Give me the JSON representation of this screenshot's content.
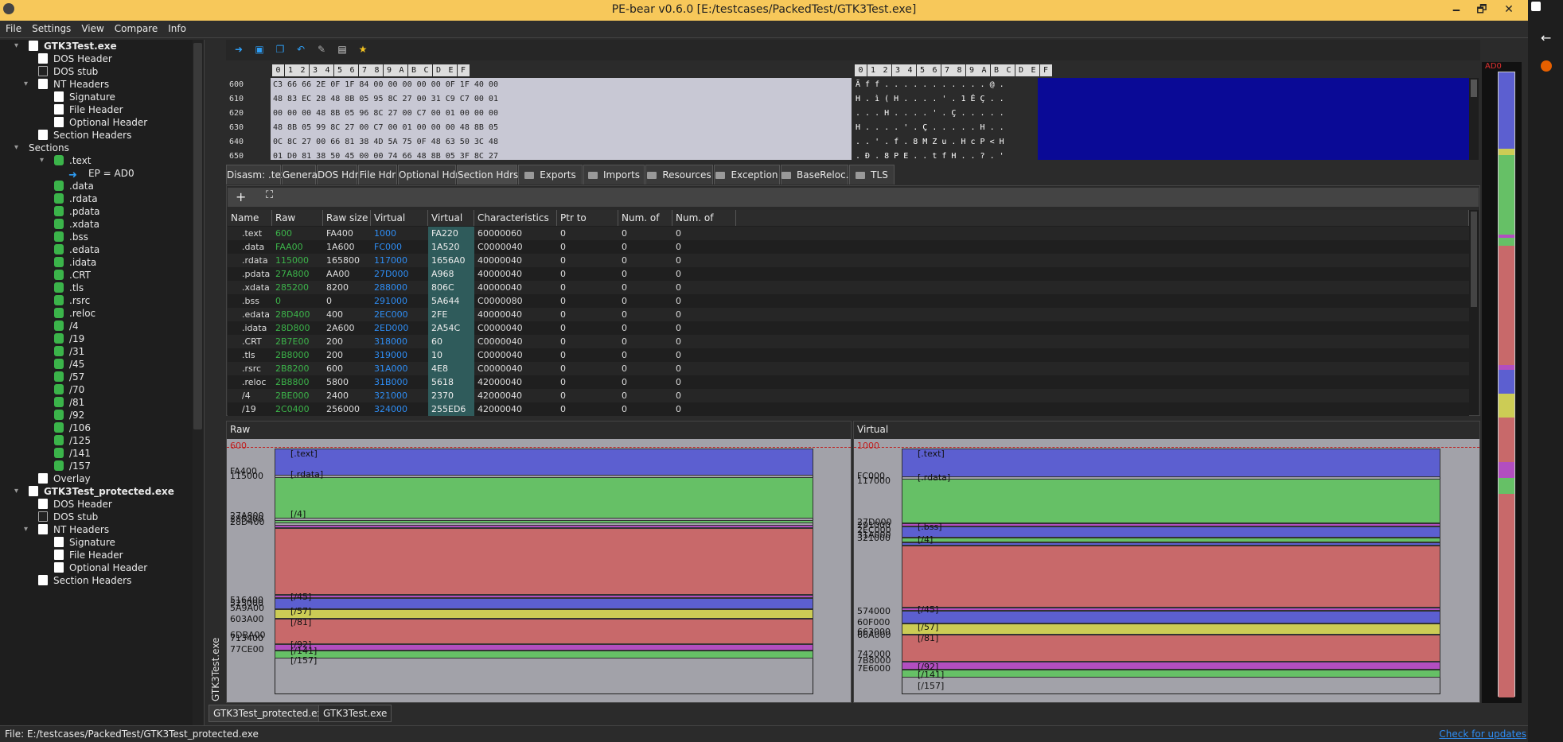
{
  "window": {
    "title": "PE-bear v0.6.0 [E:/testcases/PackedTest/GTK3Test.exe]",
    "minimize": "🗕",
    "maximize": "🗗",
    "close": "✕"
  },
  "menu": [
    "File",
    "Settings",
    "View",
    "Compare",
    "Info"
  ],
  "tree": [
    {
      "label": "GTK3Test.exe",
      "level": 0,
      "icon": "pe-file-icon",
      "bold": true,
      "expander": "▾"
    },
    {
      "label": "DOS Header",
      "level": 1,
      "icon": "page-icon"
    },
    {
      "label": "DOS stub",
      "level": 1,
      "icon": "terminal-icon"
    },
    {
      "label": "NT Headers",
      "level": 1,
      "icon": "page-icon",
      "expander": "▾"
    },
    {
      "label": "Signature",
      "level": 2,
      "icon": "page-icon"
    },
    {
      "label": "File Header",
      "level": 2,
      "icon": "page-icon"
    },
    {
      "label": "Optional Header",
      "level": 2,
      "icon": "page-icon"
    },
    {
      "label": "Section Headers",
      "level": 1,
      "icon": "page-icon"
    },
    {
      "label": "Sections",
      "level": 0.5,
      "icon": "",
      "expander": "▾"
    },
    {
      "label": ".text",
      "level": 2,
      "icon": "puzzle-icon",
      "expander": "▾"
    },
    {
      "label": "EP = AD0",
      "level": 3,
      "icon": "arrow-icon"
    },
    {
      "label": ".data",
      "level": 2,
      "icon": "puzzle-icon"
    },
    {
      "label": ".rdata",
      "level": 2,
      "icon": "puzzle-icon"
    },
    {
      "label": ".pdata",
      "level": 2,
      "icon": "puzzle-icon"
    },
    {
      "label": ".xdata",
      "level": 2,
      "icon": "puzzle-icon"
    },
    {
      "label": ".bss",
      "level": 2,
      "icon": "puzzle-icon"
    },
    {
      "label": ".edata",
      "level": 2,
      "icon": "puzzle-icon"
    },
    {
      "label": ".idata",
      "level": 2,
      "icon": "puzzle-icon"
    },
    {
      "label": ".CRT",
      "level": 2,
      "icon": "puzzle-icon"
    },
    {
      "label": ".tls",
      "level": 2,
      "icon": "puzzle-icon"
    },
    {
      "label": ".rsrc",
      "level": 2,
      "icon": "puzzle-icon"
    },
    {
      "label": ".reloc",
      "level": 2,
      "icon": "puzzle-icon"
    },
    {
      "label": "/4",
      "level": 2,
      "icon": "puzzle-icon"
    },
    {
      "label": "/19",
      "level": 2,
      "icon": "puzzle-icon"
    },
    {
      "label": "/31",
      "level": 2,
      "icon": "puzzle-icon"
    },
    {
      "label": "/45",
      "level": 2,
      "icon": "puzzle-icon"
    },
    {
      "label": "/57",
      "level": 2,
      "icon": "puzzle-icon"
    },
    {
      "label": "/70",
      "level": 2,
      "icon": "puzzle-icon"
    },
    {
      "label": "/81",
      "level": 2,
      "icon": "puzzle-icon"
    },
    {
      "label": "/92",
      "level": 2,
      "icon": "puzzle-icon"
    },
    {
      "label": "/106",
      "level": 2,
      "icon": "puzzle-icon"
    },
    {
      "label": "/125",
      "level": 2,
      "icon": "puzzle-icon"
    },
    {
      "label": "/141",
      "level": 2,
      "icon": "puzzle-icon"
    },
    {
      "label": "/157",
      "level": 2,
      "icon": "puzzle-icon"
    },
    {
      "label": "Overlay",
      "level": 1,
      "icon": "page-icon"
    },
    {
      "label": "GTK3Test_protected.exe",
      "level": 0,
      "icon": "pe-file-icon",
      "bold": true,
      "expander": "▾"
    },
    {
      "label": "DOS Header",
      "level": 1,
      "icon": "page-icon"
    },
    {
      "label": "DOS stub",
      "level": 1,
      "icon": "terminal-icon"
    },
    {
      "label": "NT Headers",
      "level": 1,
      "icon": "page-icon",
      "expander": "▾"
    },
    {
      "label": "Signature",
      "level": 2,
      "icon": "page-icon"
    },
    {
      "label": "File Header",
      "level": 2,
      "icon": "page-icon"
    },
    {
      "label": "Optional Header",
      "level": 2,
      "icon": "page-icon"
    },
    {
      "label": "Section Headers",
      "level": 1,
      "icon": "page-icon"
    }
  ],
  "vertical_tab": "GTK3Test.exe",
  "hex": {
    "columns": [
      "0",
      "1",
      "2",
      "3",
      "4",
      "5",
      "6",
      "7",
      "8",
      "9",
      "A",
      "B",
      "C",
      "D",
      "E",
      "F"
    ],
    "rows": [
      {
        "addr": "600",
        "bytes": "C3 66 66 2E 0F 1F 84 00 00 00 00 00 0F 1F 40 00",
        "ascii": "Ã f f . . . . . . . . . . . @ ."
      },
      {
        "addr": "610",
        "bytes": "48 83 EC 28 48 8B 05 95 8C 27 00 31 C9 C7 00 01",
        "ascii": "H . ì ( H . . . . ' . 1 É Ç . ."
      },
      {
        "addr": "620",
        "bytes": "00 00 00 48 8B 05 96 8C 27 00 C7 00 01 00 00 00",
        "ascii": ". . . H . . . . ' . Ç . . . . ."
      },
      {
        "addr": "630",
        "bytes": "48 8B 05 99 8C 27 00 C7 00 01 00 00 00 48 8B 05",
        "ascii": "H . . . . ' . Ç . . . . . H . ."
      },
      {
        "addr": "640",
        "bytes": "0C 8C 27 00 66 81 38 4D 5A 75 0F 48 63 50 3C 48",
        "ascii": ". . ' . f . 8 M Z u . H c P < H"
      },
      {
        "addr": "650",
        "bytes": "01 D0 81 38 50 45 00 00 74 66 48 8B 05 3F 8C 27",
        "ascii": ". Ð . 8 P E . . t f H . . ? . '"
      }
    ]
  },
  "tabs": [
    {
      "label": "Disasm: .text"
    },
    {
      "label": "General"
    },
    {
      "label": "DOS Hdr"
    },
    {
      "label": "File Hdr"
    },
    {
      "label": "Optional Hdr"
    },
    {
      "label": "Section Hdrs",
      "active": true
    },
    {
      "label": "Exports",
      "folder": true
    },
    {
      "label": "Imports",
      "folder": true
    },
    {
      "label": "Resources",
      "folder": true
    },
    {
      "label": "Exception",
      "folder": true
    },
    {
      "label": "BaseReloc.",
      "folder": true
    },
    {
      "label": "TLS",
      "folder": true
    }
  ],
  "subtool": {
    "add": "+",
    "fit": "⛶"
  },
  "table": {
    "headers": [
      "Name",
      "Raw Addr.",
      "Raw size",
      "Virtual Addr.",
      "Virtual Size",
      "Characteristics",
      "Ptr to Reloc.",
      "Num. of Reloc.",
      "Num. of Linenum."
    ],
    "rows": [
      [
        ".text",
        "600",
        "FA400",
        "1000",
        "FA220",
        "60000060",
        "0",
        "0",
        "0"
      ],
      [
        ".data",
        "FAA00",
        "1A600",
        "FC000",
        "1A520",
        "C0000040",
        "0",
        "0",
        "0"
      ],
      [
        ".rdata",
        "115000",
        "165800",
        "117000",
        "1656A0",
        "40000040",
        "0",
        "0",
        "0"
      ],
      [
        ".pdata",
        "27A800",
        "AA00",
        "27D000",
        "A968",
        "40000040",
        "0",
        "0",
        "0"
      ],
      [
        ".xdata",
        "285200",
        "8200",
        "288000",
        "806C",
        "40000040",
        "0",
        "0",
        "0"
      ],
      [
        ".bss",
        "0",
        "0",
        "291000",
        "5A644",
        "C0000080",
        "0",
        "0",
        "0"
      ],
      [
        ".edata",
        "28D400",
        "400",
        "2EC000",
        "2FE",
        "40000040",
        "0",
        "0",
        "0"
      ],
      [
        ".idata",
        "28D800",
        "2A600",
        "2ED000",
        "2A54C",
        "C0000040",
        "0",
        "0",
        "0"
      ],
      [
        ".CRT",
        "2B7E00",
        "200",
        "318000",
        "60",
        "C0000040",
        "0",
        "0",
        "0"
      ],
      [
        ".tls",
        "2B8000",
        "200",
        "319000",
        "10",
        "C0000040",
        "0",
        "0",
        "0"
      ],
      [
        ".rsrc",
        "2B8200",
        "600",
        "31A000",
        "4E8",
        "C0000040",
        "0",
        "0",
        "0"
      ],
      [
        ".reloc",
        "2B8800",
        "5800",
        "31B000",
        "5618",
        "42000040",
        "0",
        "0",
        "0"
      ],
      [
        "/4",
        "2BE000",
        "2400",
        "321000",
        "2370",
        "42000040",
        "0",
        "0",
        "0"
      ],
      [
        "/19",
        "2C0400",
        "256000",
        "324000",
        "255ED6",
        "42000040",
        "0",
        "0",
        "0"
      ]
    ]
  },
  "raw_panel": {
    "title": "Raw",
    "top_addr": "600",
    "addrs": [
      "FA400",
      "115000",
      "27A800",
      "285200",
      "28D400",
      "516400",
      "525000",
      "5A9A00",
      "603A00",
      "6DBA00",
      "713400",
      "77CE00"
    ],
    "labels": [
      "[.text]",
      "[.rdata]",
      "[/4]",
      "[/45]",
      "[/57]",
      "[/81]",
      "[/92]",
      "[/141]",
      "[/157]"
    ]
  },
  "virt_panel": {
    "title": "Virtual",
    "top_addr": "1000",
    "addrs": [
      "FC000",
      "117000",
      "27D000",
      "291000",
      "2EC000",
      "31A000",
      "321000",
      "574000",
      "60F000",
      "663000",
      "66A000",
      "742000",
      "7B8000",
      "7E6000"
    ],
    "labels": [
      "[.text]",
      "[.rdata]",
      "[.bss]",
      "[/4]",
      "[/45]",
      "[/57]",
      "[/81]",
      "[/92]",
      "[/141]",
      "[/157]"
    ]
  },
  "map": {
    "top_label": "AD0"
  },
  "bottom_tabs": [
    {
      "label": "GTK3Test_protected.exe"
    },
    {
      "label": "GTK3Test.exe",
      "active": true
    }
  ],
  "status": {
    "text": "File: E:/testcases/PackedTest/GTK3Test_protected.exe",
    "link": "Check for updates"
  },
  "colors": {
    "titlebar": "#f7c85a",
    "text_section": "#5c5fd0",
    "rdata_section": "#66c066",
    "data_red": "#c8696a",
    "yellow": "#cccc55",
    "purple": "#b24ec0",
    "hex_blue": "#0a0a96"
  }
}
